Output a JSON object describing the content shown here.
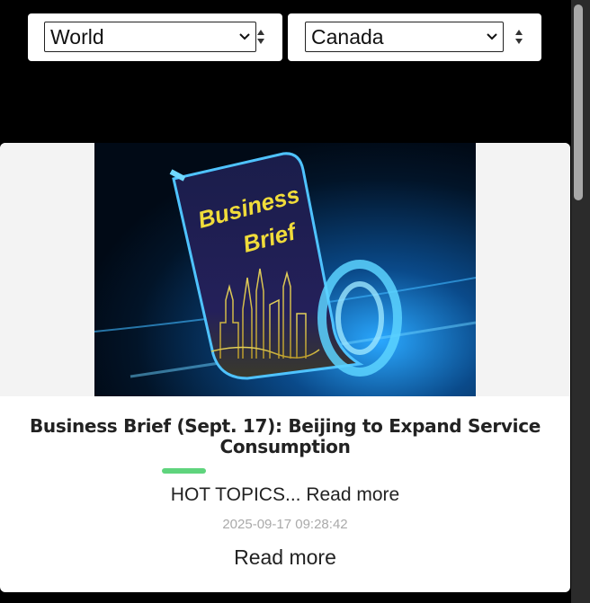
{
  "filters": {
    "region": {
      "value": "World"
    },
    "country": {
      "value": "Canada"
    }
  },
  "article": {
    "image_title_line1": "Business",
    "image_title_line2": "Brief",
    "title": "Business Brief (Sept. 17): Beijing to Expand Service Consumption",
    "excerpt": "HOT TOPICS... Read more",
    "timestamp": "2025-09-17 09:28:42",
    "read_more_label": "Read more"
  },
  "colors": {
    "accent": "#5fd47d",
    "background": "#000000",
    "card": "#ffffff"
  }
}
